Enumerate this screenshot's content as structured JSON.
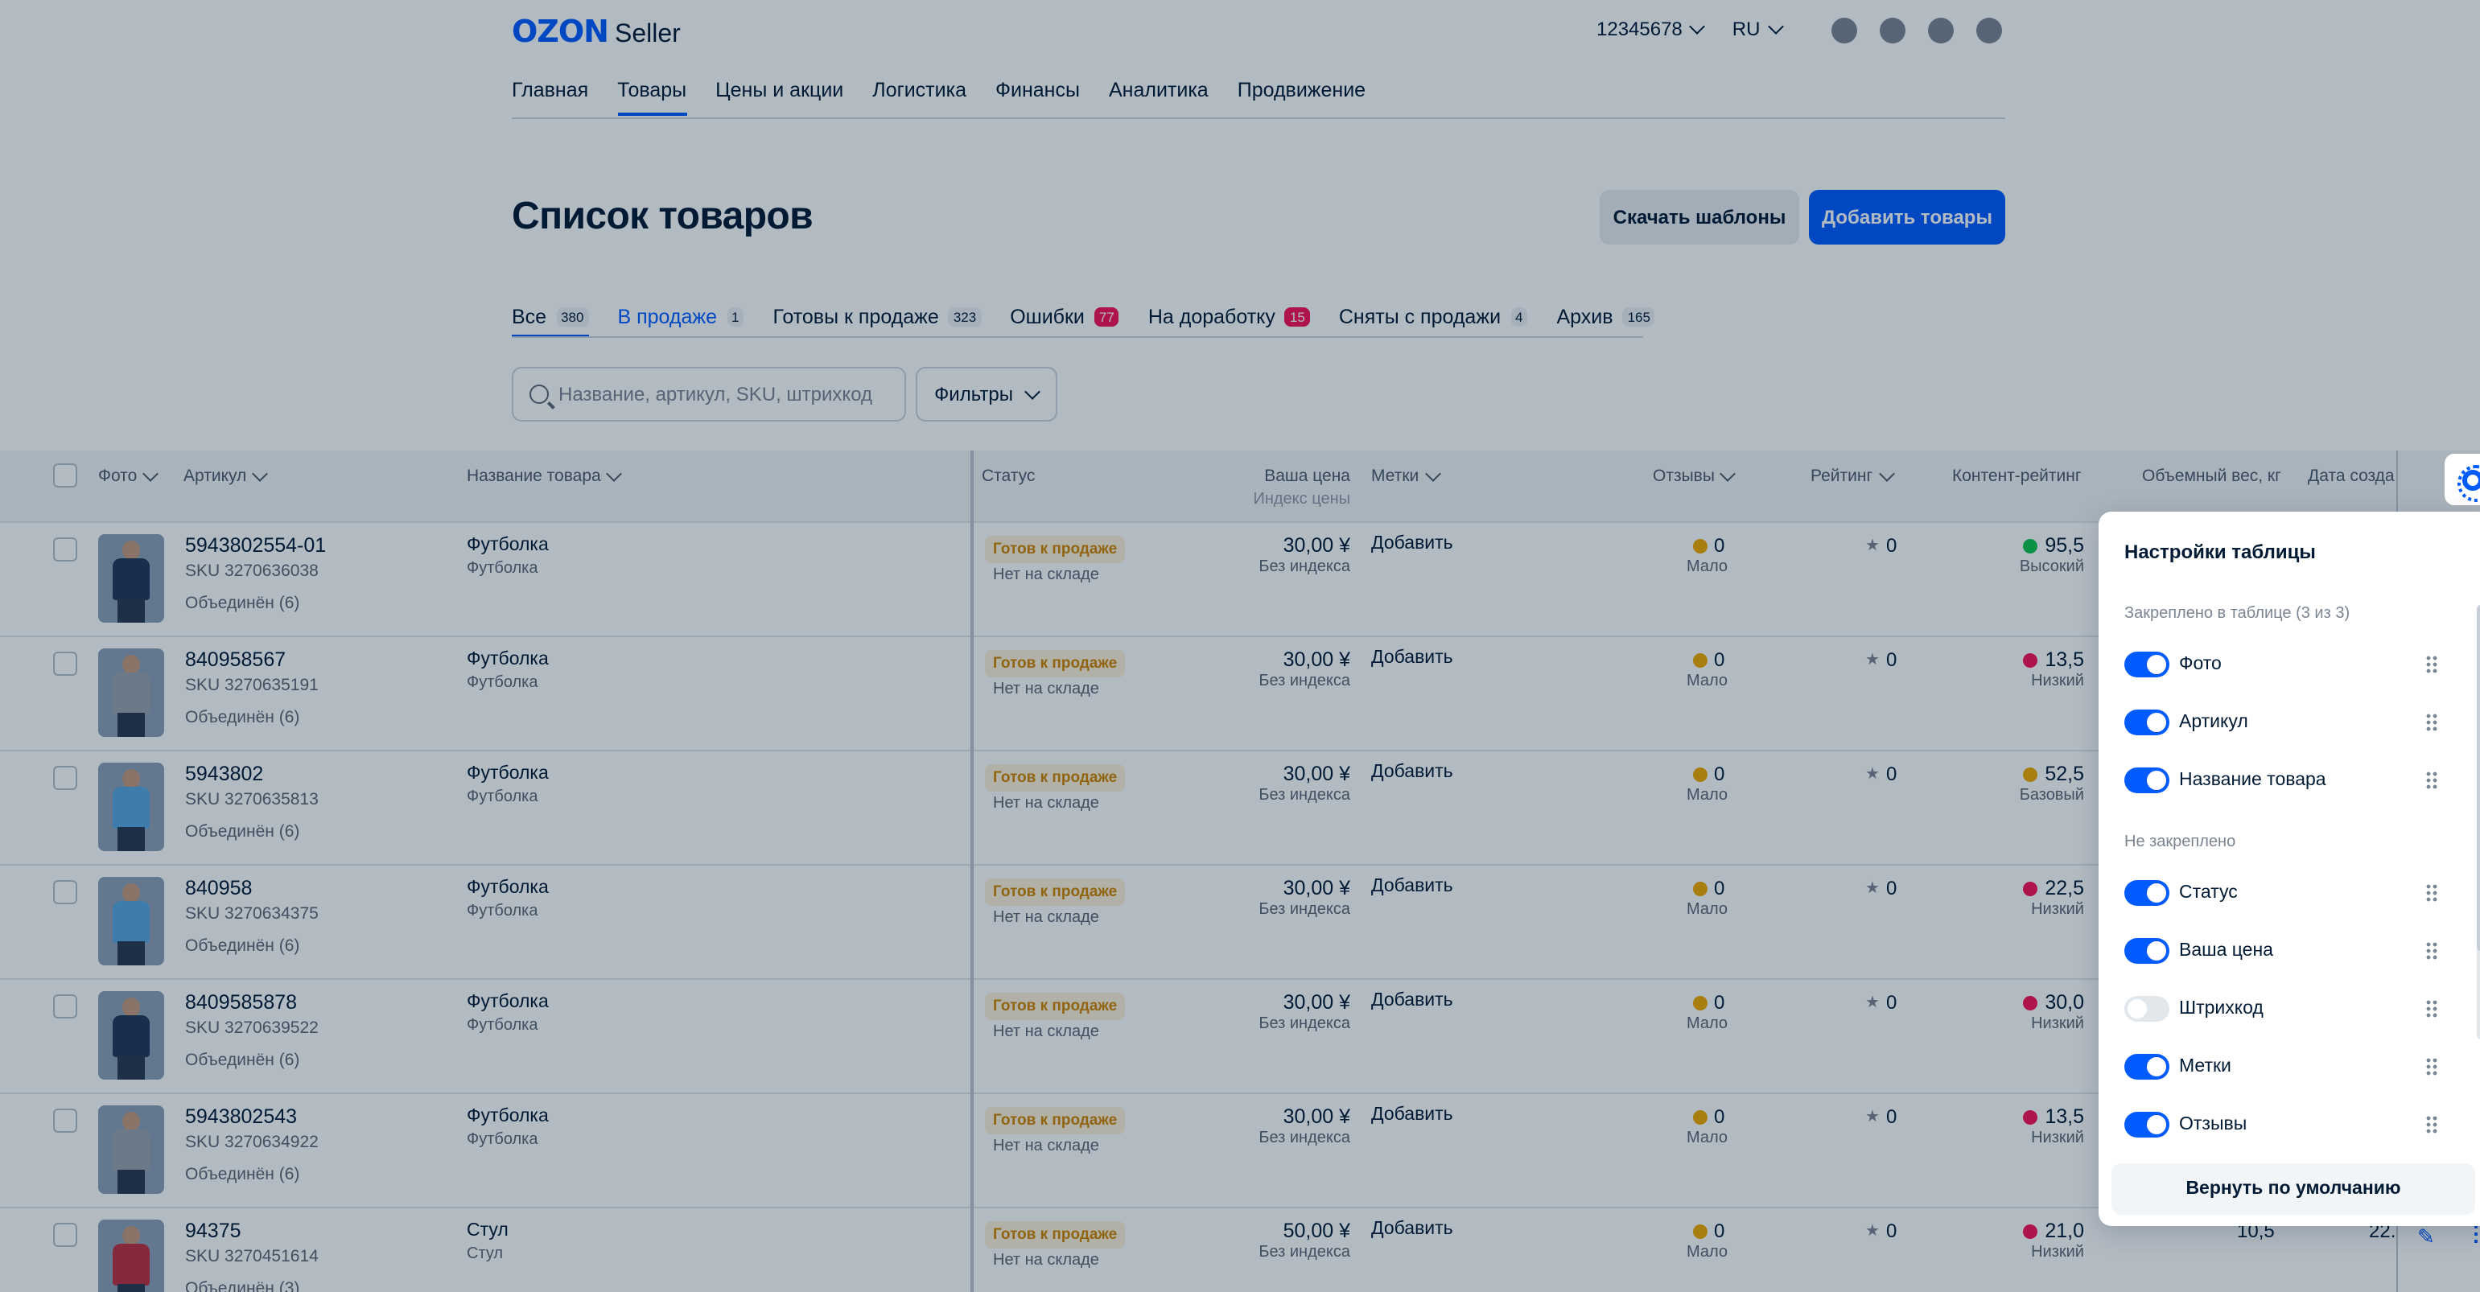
{
  "header": {
    "logo_main": "OZON",
    "logo_sub": "Seller",
    "account": "12345678",
    "lang": "RU",
    "icons": [
      "chat-icon",
      "headset-icon",
      "bell-icon",
      "profile-icon"
    ]
  },
  "nav": [
    "Главная",
    "Товары",
    "Цены и акции",
    "Логистика",
    "Финансы",
    "Аналитика",
    "Продвижение"
  ],
  "page": {
    "title": "Список товаров",
    "download_btn": "Скачать шаблоны",
    "add_btn": "Добавить товары"
  },
  "tabs": [
    {
      "label": "Все",
      "count": "380"
    },
    {
      "label": "В продаже",
      "count": "1"
    },
    {
      "label": "Готовы к продаже",
      "count": "323"
    },
    {
      "label": "Ошибки",
      "count": "77"
    },
    {
      "label": "На доработку",
      "count": "15"
    },
    {
      "label": "Сняты с продажи",
      "count": "4"
    },
    {
      "label": "Архив",
      "count": "165"
    }
  ],
  "search": {
    "placeholder": "Название, артикул, SKU, штрихкод"
  },
  "filters_label": "Фильтры",
  "columns": {
    "photo": "Фото",
    "article": "Артикул",
    "name": "Название товара",
    "status": "Статус",
    "price": "Ваша цена",
    "price_sub": "Индекс цены",
    "tags": "Метки",
    "reviews": "Отзывы",
    "rating": "Рейтинг",
    "content": "Контент-рейтинг",
    "volume": "Объемный вес, кг",
    "date": "Дата созда"
  },
  "rows": [
    {
      "article": "5943802554-01",
      "sku": "SKU 3270636038",
      "joined": "Объединён (6)",
      "name": "Футболка",
      "sub": "Футболка",
      "status": "Готов к продаже",
      "stock": "Нет на складе",
      "price": "30,00 ¥",
      "pidx": "Без индекса",
      "tag": "Добавить",
      "rev": "0",
      "rev_sub": "Мало",
      "rating": "0",
      "cr": "95,5",
      "cr_sub": "Высокий",
      "cr_color": "#10c44c",
      "shirt": "#233756"
    },
    {
      "article": "840958567",
      "sku": "SKU 3270635191",
      "joined": "Объединён (6)",
      "name": "Футболка",
      "sub": "Футболка",
      "status": "Готов к продаже",
      "stock": "Нет на складе",
      "price": "30,00 ¥",
      "pidx": "Без индекса",
      "tag": "Добавить",
      "rev": "0",
      "rev_sub": "Мало",
      "rating": "0",
      "cr": "13,5",
      "cr_sub": "Низкий",
      "cr_color": "#f91155",
      "shirt": "#9aa3ad"
    },
    {
      "article": "5943802",
      "sku": "SKU 3270635813",
      "joined": "Объединён (6)",
      "name": "Футболка",
      "sub": "Футболка",
      "status": "Готов к продаже",
      "stock": "Нет на складе",
      "price": "30,00 ¥",
      "pidx": "Без индекса",
      "tag": "Добавить",
      "rev": "0",
      "rev_sub": "Мало",
      "rating": "0",
      "cr": "52,5",
      "cr_sub": "Базовый",
      "cr_color": "#f2a900",
      "shirt": "#5aa7e0"
    },
    {
      "article": "840958",
      "sku": "SKU 3270634375",
      "joined": "Объединён (6)",
      "name": "Футболка",
      "sub": "Футболка",
      "status": "Готов к продаже",
      "stock": "Нет на складе",
      "price": "30,00 ¥",
      "pidx": "Без индекса",
      "tag": "Добавить",
      "rev": "0",
      "rev_sub": "Мало",
      "rating": "0",
      "cr": "22,5",
      "cr_sub": "Низкий",
      "cr_color": "#f91155",
      "shirt": "#5aa7e0"
    },
    {
      "article": "8409585878",
      "sku": "SKU 3270639522",
      "joined": "Объединён (6)",
      "name": "Футболка",
      "sub": "Футболка",
      "status": "Готов к продаже",
      "stock": "Нет на складе",
      "price": "30,00 ¥",
      "pidx": "Без индекса",
      "tag": "Добавить",
      "rev": "0",
      "rev_sub": "Мало",
      "rating": "0",
      "cr": "30,0",
      "cr_sub": "Низкий",
      "cr_color": "#f91155",
      "shirt": "#233756"
    },
    {
      "article": "5943802543",
      "sku": "SKU 3270634922",
      "joined": "Объединён (6)",
      "name": "Футболка",
      "sub": "Футболка",
      "status": "Готов к продаже",
      "stock": "Нет на складе",
      "price": "30,00 ¥",
      "pidx": "Без индекса",
      "tag": "Добавить",
      "rev": "0",
      "rev_sub": "Мало",
      "rating": "0",
      "cr": "13,5",
      "cr_sub": "Низкий",
      "cr_color": "#f91155",
      "shirt": "#9aa3ad"
    },
    {
      "article": "94375",
      "sku": "SKU 3270451614",
      "joined": "Объединён (3)",
      "name": "Стул",
      "sub": "Стул",
      "status": "Готов к продаже",
      "stock": "Нет на складе",
      "price": "50,00 ¥",
      "pidx": "Без индекса",
      "tag": "Добавить",
      "rev": "0",
      "rev_sub": "Мало",
      "rating": "0",
      "cr": "21,0",
      "cr_sub": "Низкий",
      "cr_color": "#f91155",
      "shirt": "#c03040",
      "volume": "10,5",
      "date": "22."
    }
  ],
  "panel": {
    "title": "Настройки таблицы",
    "pinned_label": "Закреплено в таблице (3 из 3)",
    "unpinned_label": "Не закреплено",
    "pinned": [
      {
        "label": "Фото",
        "on": true
      },
      {
        "label": "Артикул",
        "on": true
      },
      {
        "label": "Название товара",
        "on": true
      }
    ],
    "unpinned": [
      {
        "label": "Статус",
        "on": true
      },
      {
        "label": "Ваша цена",
        "on": true
      },
      {
        "label": "Штрихкод",
        "on": false
      },
      {
        "label": "Метки",
        "on": true
      },
      {
        "label": "Отзывы",
        "on": true
      }
    ],
    "reset": "Вернуть по умолчанию"
  }
}
